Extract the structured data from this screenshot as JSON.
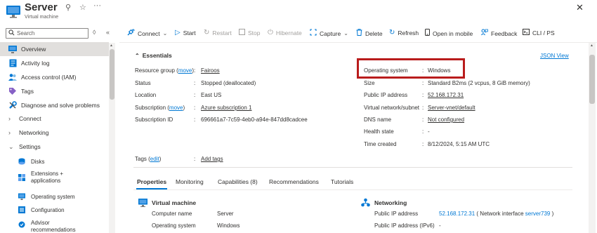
{
  "header": {
    "title": "Server",
    "subtitle": "Virtual machine",
    "pin_glyph": "⚲",
    "star_glyph": "☆",
    "more_glyph": "···",
    "close_glyph": "✕"
  },
  "sidebar": {
    "search_placeholder": "Search",
    "items": [
      {
        "label": "Overview"
      },
      {
        "label": "Activity log"
      },
      {
        "label": "Access control (IAM)"
      },
      {
        "label": "Tags"
      },
      {
        "label": "Diagnose and solve problems"
      },
      {
        "label": "Connect"
      },
      {
        "label": "Networking"
      },
      {
        "label": "Settings"
      }
    ],
    "settings_children": [
      {
        "label": "Disks"
      },
      {
        "label": "Extensions +\napplications"
      },
      {
        "label": "Operating system"
      },
      {
        "label": "Configuration"
      },
      {
        "label": "Advisor\nrecommendations"
      }
    ]
  },
  "toolbar": {
    "connect": "Connect",
    "start": "Start",
    "restart": "Restart",
    "stop": "Stop",
    "hibernate": "Hibernate",
    "capture": "Capture",
    "delete": "Delete",
    "refresh": "Refresh",
    "open_mobile": "Open in mobile",
    "feedback": "Feedback",
    "cli_ps": "CLI / PS"
  },
  "essentials": {
    "title": "Essentials",
    "json_view": "JSON View",
    "left": [
      {
        "label": "Resource group",
        "move": "move",
        "value": "Fairoos",
        "link": true
      },
      {
        "label": "Status",
        "value": "Stopped (deallocated)"
      },
      {
        "label": "Location",
        "value": "East US"
      },
      {
        "label": "Subscription",
        "move": "move",
        "value": "Azure subscription 1",
        "link": true
      },
      {
        "label": "Subscription ID",
        "value": "696661a7-7c59-4eb0-a94e-847dd8cadcee"
      }
    ],
    "right": [
      {
        "label": "Operating system",
        "value": "Windows"
      },
      {
        "label": "Size",
        "value": "Standard B2ms (2 vcpus, 8 GiB memory)"
      },
      {
        "label": "Public IP address",
        "value": "52.168.172.31",
        "link": true
      },
      {
        "label": "Virtual network/subnet",
        "value": "Server-vnet/default",
        "link": true
      },
      {
        "label": "DNS name",
        "value": "Not configured",
        "link": true
      },
      {
        "label": "Health state",
        "value": "-"
      },
      {
        "label": "Time created",
        "value": "8/12/2024, 5:15 AM UTC"
      }
    ],
    "tags_label": "Tags",
    "tags_edit": "edit",
    "tags_value": "Add tags"
  },
  "tabs": [
    "Properties",
    "Monitoring",
    "Capabilities (8)",
    "Recommendations",
    "Tutorials"
  ],
  "properties": {
    "vm_section": "Virtual machine",
    "vm_rows": [
      {
        "label": "Computer name",
        "value": "Server"
      },
      {
        "label": "Operating system",
        "value": "Windows"
      }
    ],
    "net_section": "Networking",
    "net_rows": [
      {
        "label": "Public IP address",
        "value": "52.168.172.31",
        "extra_prefix": "( Network interface ",
        "extra_link": "server739",
        "extra_suffix": " )"
      },
      {
        "label": "Public IP address (IPv6)",
        "value": "-"
      }
    ]
  },
  "colors": {
    "accent": "#0078d4",
    "highlight": "#b91c1c",
    "active_bg": "#e1dfdd"
  }
}
